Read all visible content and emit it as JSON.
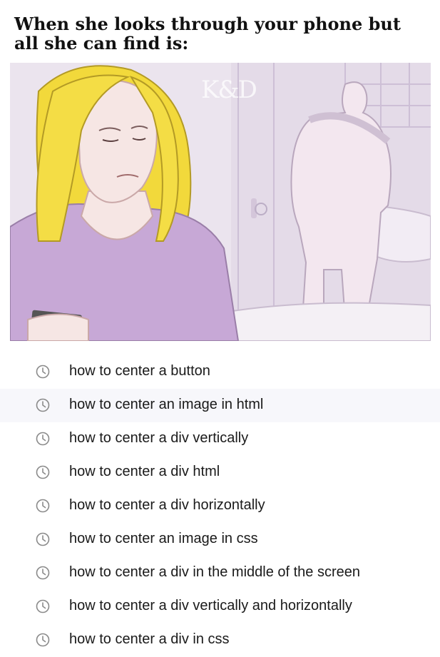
{
  "caption": "When she looks through your phone but all she can find is:",
  "watermark": "K&D",
  "history": [
    {
      "text": "how to center a button",
      "icon": "history-clock-icon"
    },
    {
      "text": "how to center an image in html",
      "icon": "history-clock-icon",
      "highlighted": true
    },
    {
      "text": "how to center a div vertically",
      "icon": "history-clock-icon"
    },
    {
      "text": "how to center a div html",
      "icon": "history-clock-icon"
    },
    {
      "text": "how to center a div horizontally",
      "icon": "history-clock-icon"
    },
    {
      "text": "how to center an image in css",
      "icon": "history-clock-icon"
    },
    {
      "text": "how to center a div in the middle of the screen",
      "icon": "history-clock-icon"
    },
    {
      "text": "how to center a div vertically and horizontally",
      "icon": "history-clock-icon"
    },
    {
      "text": "how to center a div in css",
      "icon": "history-clock-icon"
    }
  ],
  "colors": {
    "hair": "#f2d93b",
    "shirt": "#c7a8d6",
    "skin": "#f6e6e4",
    "wall": "#ece6ef",
    "icon": "#8a8a8a"
  }
}
